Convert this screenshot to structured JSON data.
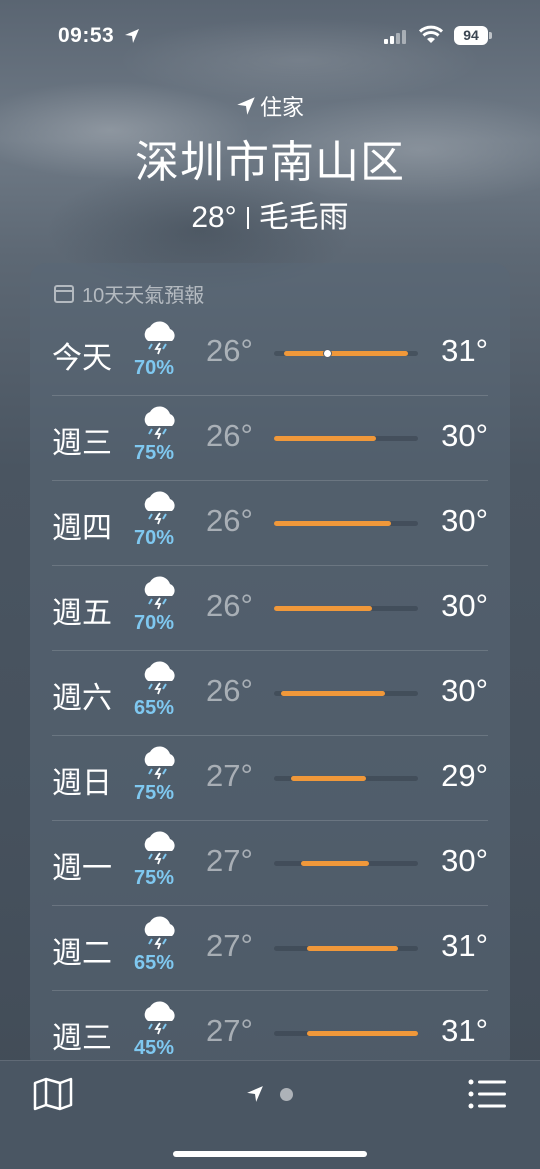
{
  "status": {
    "time": "09:53",
    "battery": "94"
  },
  "header": {
    "home_label": "住家",
    "city": "深圳市南山区",
    "current_temp": "28°",
    "condition": "毛毛雨"
  },
  "forecast": {
    "title": "10天天氣預報",
    "days": [
      {
        "day": "今天",
        "prob": "70%",
        "low": "26°",
        "high": "31°",
        "icon": "thunderstorm-icon",
        "bar_start": 0.07,
        "bar_end": 0.93,
        "current": 0.37
      },
      {
        "day": "週三",
        "prob": "75%",
        "low": "26°",
        "high": "30°",
        "icon": "thunderstorm-icon",
        "bar_start": 0.0,
        "bar_end": 0.71
      },
      {
        "day": "週四",
        "prob": "70%",
        "low": "26°",
        "high": "30°",
        "icon": "thunderstorm-icon",
        "bar_start": 0.0,
        "bar_end": 0.81
      },
      {
        "day": "週五",
        "prob": "70%",
        "low": "26°",
        "high": "30°",
        "icon": "thunderstorm-icon",
        "bar_start": 0.0,
        "bar_end": 0.68
      },
      {
        "day": "週六",
        "prob": "65%",
        "low": "26°",
        "high": "30°",
        "icon": "thunderstorm-icon",
        "bar_start": 0.05,
        "bar_end": 0.77
      },
      {
        "day": "週日",
        "prob": "75%",
        "low": "27°",
        "high": "29°",
        "icon": "thunderstorm-icon",
        "bar_start": 0.12,
        "bar_end": 0.64
      },
      {
        "day": "週一",
        "prob": "75%",
        "low": "27°",
        "high": "30°",
        "icon": "thunderstorm-icon",
        "bar_start": 0.19,
        "bar_end": 0.66
      },
      {
        "day": "週二",
        "prob": "65%",
        "low": "27°",
        "high": "31°",
        "icon": "thunderstorm-icon",
        "bar_start": 0.23,
        "bar_end": 0.86
      },
      {
        "day": "週三",
        "prob": "45%",
        "low": "27°",
        "high": "31°",
        "icon": "thunderstorm-icon",
        "bar_start": 0.23,
        "bar_end": 1.0
      }
    ]
  },
  "colors": {
    "bar": "#f0983a",
    "prob": "#7fc8f0"
  }
}
